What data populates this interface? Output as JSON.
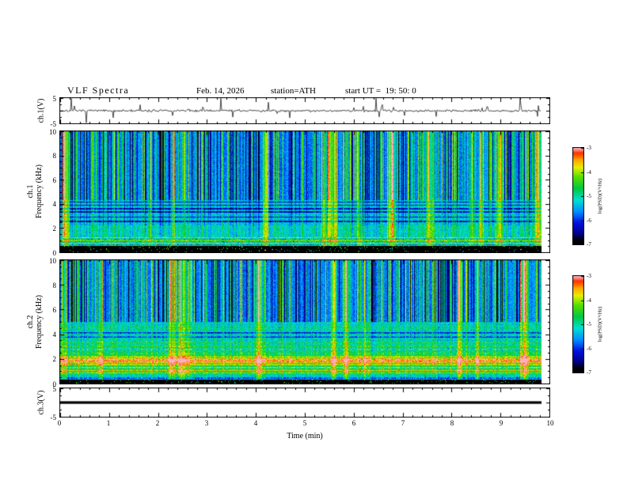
{
  "header": {
    "title": "VLF Spectra",
    "date": "Feb. 14, 2026",
    "station": "station=ATH",
    "start_ut": "start UT =  19: 50: 0"
  },
  "x_axis": {
    "label": "Time (min)",
    "ticks": [
      "0",
      "1",
      "2",
      "3",
      "4",
      "5",
      "6",
      "7",
      "8",
      "9",
      "10"
    ]
  },
  "spec_y_ticks": [
    "10",
    "8",
    "6",
    "4",
    "2",
    "0"
  ],
  "wave_y_ticks": [
    "5",
    "-5"
  ],
  "y_axis_labels": {
    "wave1": "ch.1(V)",
    "spec1_line1": "ch.1",
    "spec1_line2": "Frequency (kHz)",
    "spec2_line1": "ch.2",
    "spec2_line2": "Frequency (kHz)",
    "wave3": "ch.3(V)"
  },
  "colorbar": {
    "label": "log(PSD)(V²/Hz)",
    "ticks": [
      "-3",
      "-4",
      "-5",
      "-6",
      "-7"
    ],
    "min": -7,
    "max": -3
  },
  "colormap": [
    {
      "t": 0.0,
      "c": "#000000"
    },
    {
      "t": 0.05,
      "c": "#000010"
    },
    {
      "t": 0.1,
      "c": "#000080"
    },
    {
      "t": 0.22,
      "c": "#0010e0"
    },
    {
      "t": 0.34,
      "c": "#0090ff"
    },
    {
      "t": 0.46,
      "c": "#00e0d0"
    },
    {
      "t": 0.58,
      "c": "#00c840"
    },
    {
      "t": 0.7,
      "c": "#58e000"
    },
    {
      "t": 0.8,
      "c": "#e8f000"
    },
    {
      "t": 0.88,
      "c": "#ffa000"
    },
    {
      "t": 0.95,
      "c": "#ff3000"
    },
    {
      "t": 1.0,
      "c": "#ffb0c0"
    }
  ],
  "render": {
    "data_fraction": 0.982,
    "wave1": {
      "seed": 7,
      "noise_sigma": 0.45,
      "spike_prob": 0.045,
      "spike_scale": 1.6
    },
    "spec1": {
      "seed": 42,
      "black_top_khz": 0.55,
      "bright_band": [
        0.55,
        1.25
      ],
      "cyan_band_top": 4.3,
      "dark_rows": [
        2.55,
        2.9,
        3.35,
        3.6,
        3.9,
        4.15
      ],
      "n_events": 14
    },
    "spec2": {
      "seed": 1337,
      "black_top_khz": 0.3,
      "stripes": [
        [
          1.95,
          0.1,
          0.5
        ],
        [
          1.75,
          0.07,
          0.36
        ],
        [
          1.55,
          0.06,
          0.3
        ],
        [
          1.3,
          0.06,
          0.27
        ],
        [
          1.05,
          0.05,
          0.34
        ],
        [
          0.85,
          0.05,
          0.24
        ],
        [
          2.2,
          0.06,
          0.24
        ],
        [
          2.45,
          0.05,
          0.2
        ],
        [
          2.75,
          0.05,
          0.16
        ],
        [
          3.05,
          0.04,
          0.14
        ],
        [
          3.35,
          0.04,
          0.12
        ]
      ],
      "dark_rows": [
        0.45,
        3.8,
        4.1
      ],
      "streak_top_khz": 5.0,
      "n_events": 12
    }
  },
  "chart_data": [
    {
      "type": "line",
      "panel": "ch1_waveform",
      "title": "VLF Spectra",
      "ylabel": "ch.1(V)",
      "xlabel": "Time (min)",
      "xlim": [
        0,
        10
      ],
      "ylim": [
        -5,
        5
      ],
      "data_extent_min": [
        0,
        9.8
      ],
      "description": "Channel 1 voltage time series: tight noisy baseline near 0 V with frequent impulsive sferic spikes reaching roughly ±2 to ±5 V throughout the 10-minute record."
    },
    {
      "type": "heatmap",
      "panel": "ch1_spectrogram",
      "ylabel": "ch.1 Frequency (kHz)",
      "xlabel": "Time (min)",
      "xlim": [
        0,
        10
      ],
      "ylim": [
        0,
        10
      ],
      "colorbar": {
        "label": "log(PSD)(V²/Hz)",
        "min": -7,
        "max": -3,
        "ticks": [
          -3,
          -4,
          -5,
          -6,
          -7
        ]
      },
      "features": [
        "solid black band below about 0.5 kHz (PSD below -7)",
        "bright multicolour interference band from about 0.5 to 1.2 kHz",
        "cyan/teal region 1.2 to 4.3 kHz crossed by several dark horizontal lines near 2.5-4.2 kHz",
        "blue region 4.3 to 10 kHz dominated by dense vertical sferic streaks alternating dark navy and green",
        "occasional full-height bright green/yellow columns, e.g. near 1.2 and 4.2 min"
      ]
    },
    {
      "type": "heatmap",
      "panel": "ch2_spectrogram",
      "ylabel": "ch.2 Frequency (kHz)",
      "xlabel": "Time (min)",
      "xlim": [
        0,
        10
      ],
      "ylim": [
        0,
        10
      ],
      "colorbar": {
        "label": "log(PSD)(V²/Hz)",
        "min": -7,
        "max": -3,
        "ticks": [
          -3,
          -4,
          -5,
          -6,
          -7
        ]
      },
      "features": [
        "thin black band below about 0.3 kHz",
        "strong horizontal yellow/orange/red interference stripes between about 0.8 and 2.5 kHz, strongest near 2 kHz",
        "green/cyan horizontally striped region 2.5 to 5 kHz",
        "blue region 5 to 10 kHz with dense vertical sferic streaks like channel 1"
      ]
    },
    {
      "type": "line",
      "panel": "ch3_waveform",
      "ylabel": "ch.3(V)",
      "xlabel": "Time (min)",
      "xlim": [
        0,
        10
      ],
      "ylim": [
        -5,
        5
      ],
      "data_extent_min": [
        0,
        9.8
      ],
      "description": "Channel 3 voltage: perfectly flat heavy black line at 0 V (channel off / no signal)."
    }
  ]
}
